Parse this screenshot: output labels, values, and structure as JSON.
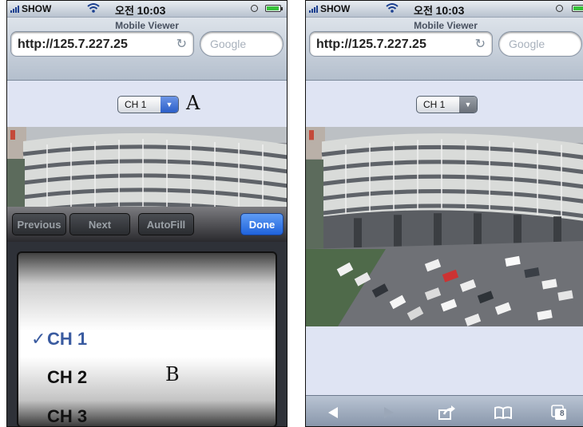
{
  "status_bar": {
    "carrier": "SHOW",
    "time_prefix": "오전",
    "time": "10:03"
  },
  "browser": {
    "page_title": "Mobile Viewer",
    "url": "http://125.7.227.25",
    "search_placeholder": "Google"
  },
  "channel_select": {
    "selected": "CH 1"
  },
  "annotations": {
    "a": "A",
    "b": "B"
  },
  "keyboard_accessory": {
    "previous": "Previous",
    "next": "Next",
    "autofill": "AutoFill",
    "done": "Done"
  },
  "picker": {
    "items": [
      "CH 1",
      "CH 2",
      "CH 3"
    ],
    "checkmark": "✓"
  },
  "toolbar": {
    "tabs_count": "8"
  },
  "icons": [
    "wifi-icon",
    "clock-icon",
    "battery-icon",
    "reload-icon",
    "dropdown-arrow-icon",
    "back-arrow-icon",
    "forward-arrow-icon",
    "share-icon",
    "bookmarks-icon",
    "tabs-icon"
  ],
  "colors": {
    "done_button": "#1f63dc",
    "selected_item": "#3a5ba0",
    "page_background": "#dfe4f3"
  }
}
